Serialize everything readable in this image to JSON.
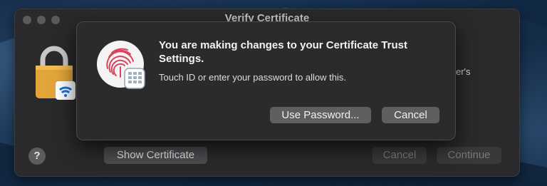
{
  "window": {
    "title": "Verify Certificate",
    "partial_text": "er's",
    "help_label": "?",
    "show_certificate_label": "Show Certificate",
    "cancel_label": "Cancel",
    "continue_label": "Continue"
  },
  "sheet": {
    "title": "You are making changes to your Certificate Trust Settings.",
    "message": "Touch ID or enter your password to allow this.",
    "use_password_label": "Use Password...",
    "cancel_label": "Cancel"
  },
  "icons": [
    "lock-icon",
    "wifi-icon",
    "touch-id-icon",
    "keypad-icon"
  ],
  "colors": {
    "fingerprint": "#d9435b",
    "wifi_badge": "#1a6fd8",
    "lock_body": "#e3a43a"
  }
}
